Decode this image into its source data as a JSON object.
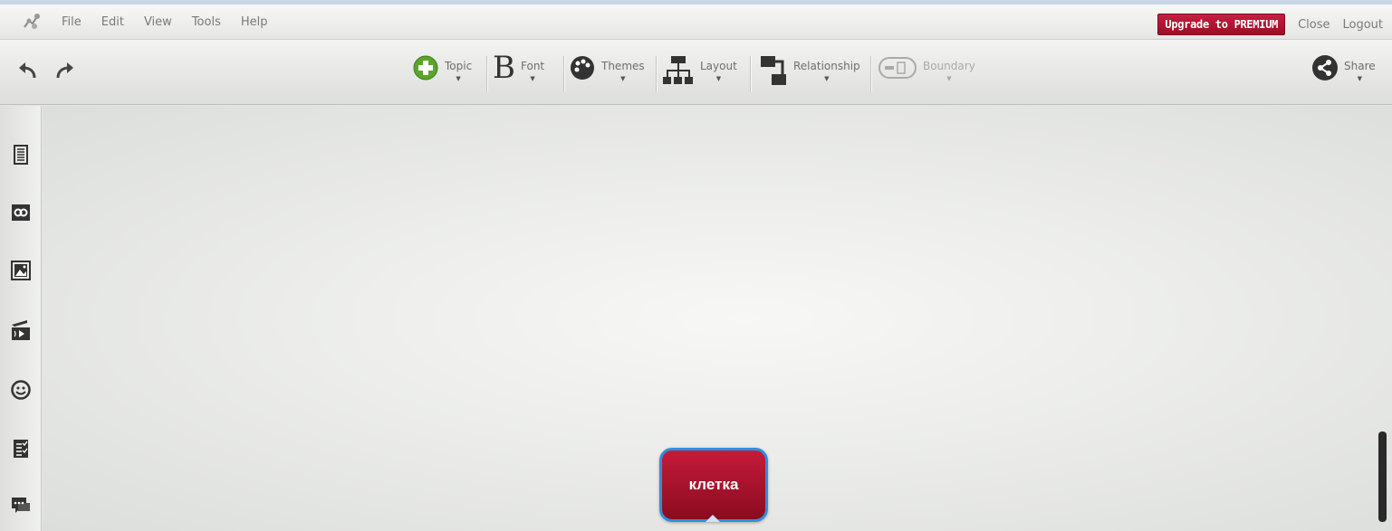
{
  "menubar": {
    "logo_icon": "mindmap-logo-icon",
    "items": [
      "File",
      "Edit",
      "View",
      "Tools",
      "Help"
    ],
    "upgrade_label": "Upgrade to PREMIUM",
    "close_label": "Close",
    "logout_label": "Logout"
  },
  "toolbar": {
    "undo_icon": "undo-icon",
    "redo_icon": "redo-icon",
    "tools": {
      "topic": "Topic",
      "font": "Font",
      "themes": "Themes",
      "layout": "Layout",
      "relationship": "Relationship",
      "boundary": "Boundary",
      "share": "Share"
    }
  },
  "sidebar": {
    "icons": [
      "notes-icon",
      "link-icon",
      "image-icon",
      "media-icon",
      "smiley-icon",
      "task-icon",
      "comment-icon"
    ]
  },
  "canvas": {
    "central_topic": "клетка"
  },
  "colors": {
    "accent_red": "#b5142f",
    "selection_blue": "#2d8fdc",
    "topic_green": "#5aa52a"
  }
}
